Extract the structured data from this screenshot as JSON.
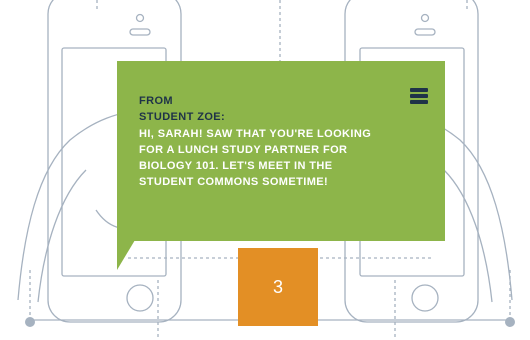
{
  "message": {
    "from_label": "FROM",
    "sender": "STUDENT ZOE:",
    "body": "HI, SARAH! SAW THAT YOU'RE LOOKING FOR A LUNCH STUDY PARTNER FOR BIOLOGY 101. LET'S MEET IN THE STUDENT COMMONS SOMETIME!"
  },
  "step_number": "3",
  "colors": {
    "card": "#8db54a",
    "badge": "#e38f25",
    "line_art": "#a6b2c0",
    "heading_text": "#1f3348",
    "body_text": "#ffffff"
  },
  "icons": {
    "menu": "hamburger-menu-icon"
  }
}
